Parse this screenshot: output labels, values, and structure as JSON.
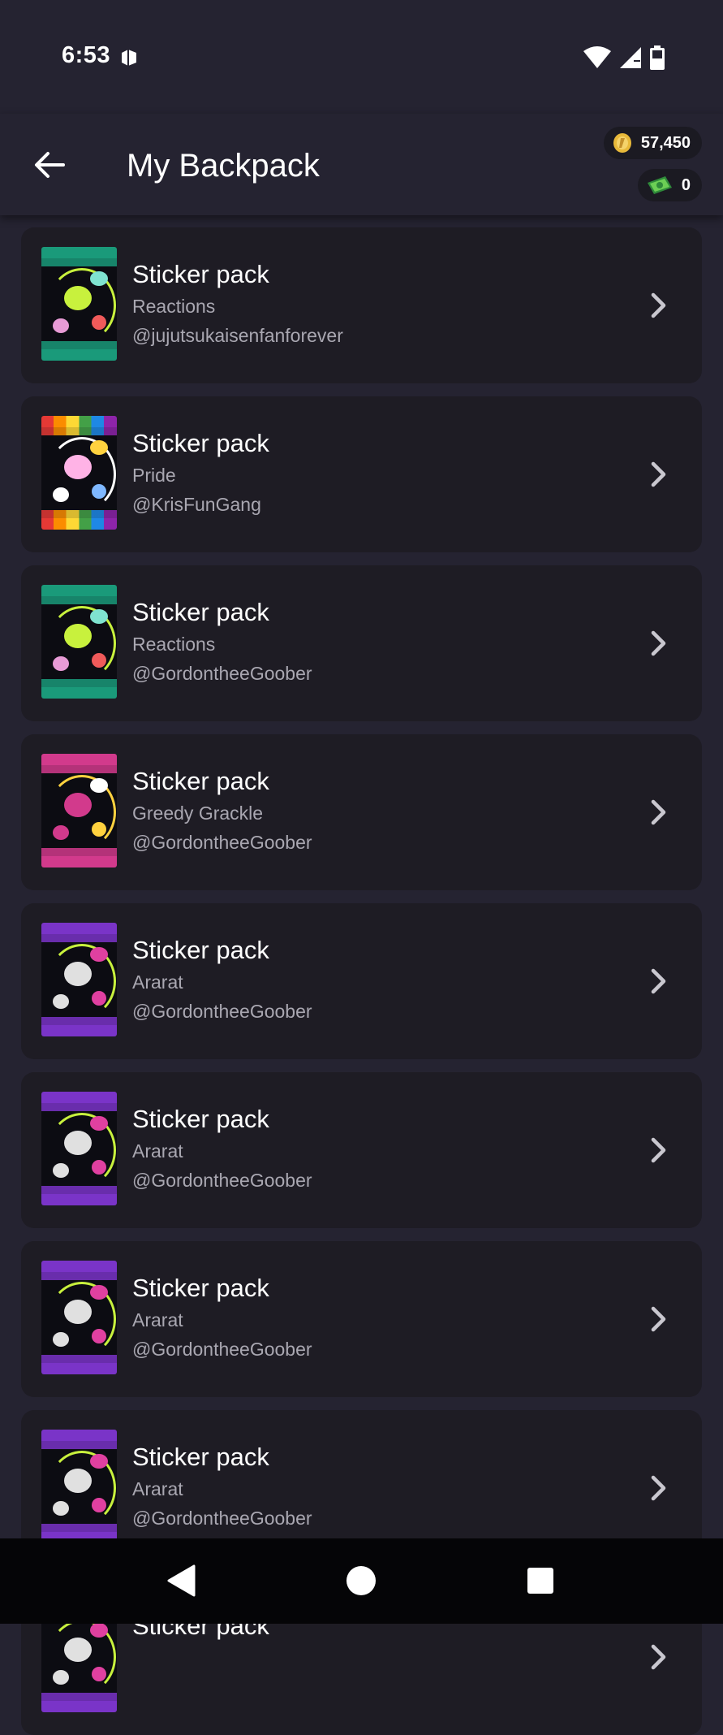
{
  "status": {
    "time": "6:53"
  },
  "header": {
    "title": "My Backpack",
    "gold": "57,450",
    "cash": "0"
  },
  "items": [
    {
      "title": "Sticker pack",
      "subtitle": "Reactions",
      "user": "@jujutsukaisenfanforever",
      "theme": "reactions"
    },
    {
      "title": "Sticker pack",
      "subtitle": "Pride",
      "user": "@KrisFunGang",
      "theme": "pride"
    },
    {
      "title": "Sticker pack",
      "subtitle": "Reactions",
      "user": "@GordontheeGoober",
      "theme": "reactions"
    },
    {
      "title": "Sticker pack",
      "subtitle": "Greedy Grackle",
      "user": "@GordontheeGoober",
      "theme": "grackle"
    },
    {
      "title": "Sticker pack",
      "subtitle": "Ararat",
      "user": "@GordontheeGoober",
      "theme": "ararat"
    },
    {
      "title": "Sticker pack",
      "subtitle": "Ararat",
      "user": "@GordontheeGoober",
      "theme": "ararat"
    },
    {
      "title": "Sticker pack",
      "subtitle": "Ararat",
      "user": "@GordontheeGoober",
      "theme": "ararat"
    },
    {
      "title": "Sticker pack",
      "subtitle": "Ararat",
      "user": "@GordontheeGoober",
      "theme": "ararat"
    },
    {
      "title": "Sticker pack",
      "subtitle": "",
      "user": "",
      "theme": "ararat"
    }
  ],
  "colors": {
    "background": "#252331",
    "card": "#1e1c24",
    "secondary_text": "#a9a7b1",
    "reactions": "#1a9a7a",
    "grackle": "#d23a8c",
    "ararat": "#7a34c8",
    "accent_lime": "#c8f13d"
  },
  "icons": [
    "back-arrow-icon",
    "gold-coin-icon",
    "cash-icon",
    "chevron-right-icon",
    "wifi-icon",
    "signal-icon",
    "battery-icon",
    "nav-back-icon",
    "nav-home-icon",
    "nav-recents-icon"
  ]
}
